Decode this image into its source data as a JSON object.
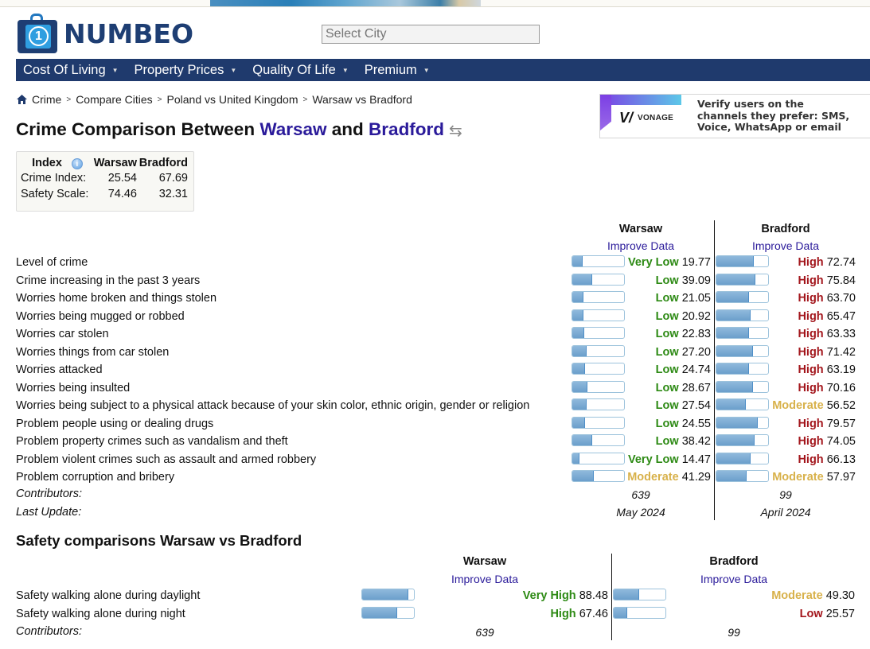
{
  "header": {
    "logo_text": "NUMBEO",
    "search_placeholder": "Select City"
  },
  "nav": [
    {
      "label": "Cost Of Living"
    },
    {
      "label": "Property Prices"
    },
    {
      "label": "Quality Of Life"
    },
    {
      "label": "Premium"
    }
  ],
  "breadcrumb": [
    "Crime",
    "Compare Cities",
    "Poland vs United Kingdom",
    "Warsaw vs Bradford"
  ],
  "ad": {
    "brand": "VONAGE",
    "copy_lines": [
      "Verify users on the",
      "channels they prefer: SMS,",
      "Voice, WhatsApp or email"
    ]
  },
  "title": {
    "prefix": "Crime Comparison Between ",
    "city1": "Warsaw",
    "middle": " and ",
    "city2": "Bradford",
    "swap_icon": "⇆"
  },
  "index_table": {
    "headers": [
      "Index",
      "Warsaw",
      "Bradford"
    ],
    "rows": [
      {
        "label": "Crime Index:",
        "warsaw": "25.54",
        "bradford": "67.69"
      },
      {
        "label": "Safety Scale:",
        "warsaw": "74.46",
        "bradford": "32.31"
      }
    ]
  },
  "crime": {
    "cities": [
      "Warsaw",
      "Bradford"
    ],
    "improve_label": "Improve Data",
    "rows": [
      {
        "label": "Level of crime",
        "w": {
          "level": "Very Low",
          "value": 19.77,
          "tone": "green"
        },
        "b": {
          "level": "High",
          "value": 72.74,
          "tone": "red"
        }
      },
      {
        "label": "Crime increasing in the past 3 years",
        "w": {
          "level": "Low",
          "value": 39.09,
          "tone": "green"
        },
        "b": {
          "level": "High",
          "value": 75.84,
          "tone": "red"
        }
      },
      {
        "label": "Worries home broken and things stolen",
        "w": {
          "level": "Low",
          "value": 21.05,
          "tone": "green"
        },
        "b": {
          "level": "High",
          "value": 63.7,
          "tone": "red"
        }
      },
      {
        "label": "Worries being mugged or robbed",
        "w": {
          "level": "Low",
          "value": 20.92,
          "tone": "green"
        },
        "b": {
          "level": "High",
          "value": 65.47,
          "tone": "red"
        }
      },
      {
        "label": "Worries car stolen",
        "w": {
          "level": "Low",
          "value": 22.83,
          "tone": "green"
        },
        "b": {
          "level": "High",
          "value": 63.33,
          "tone": "red"
        }
      },
      {
        "label": "Worries things from car stolen",
        "w": {
          "level": "Low",
          "value": 27.2,
          "tone": "green"
        },
        "b": {
          "level": "High",
          "value": 71.42,
          "tone": "red"
        }
      },
      {
        "label": "Worries attacked",
        "w": {
          "level": "Low",
          "value": 24.74,
          "tone": "green"
        },
        "b": {
          "level": "High",
          "value": 63.19,
          "tone": "red"
        }
      },
      {
        "label": "Worries being insulted",
        "w": {
          "level": "Low",
          "value": 28.67,
          "tone": "green"
        },
        "b": {
          "level": "High",
          "value": 70.16,
          "tone": "red"
        }
      },
      {
        "label": "Worries being subject to a physical attack because of your skin color, ethnic origin, gender or religion",
        "w": {
          "level": "Low",
          "value": 27.54,
          "tone": "green"
        },
        "b": {
          "level": "Moderate",
          "value": 56.52,
          "tone": "mod"
        }
      },
      {
        "label": "Problem people using or dealing drugs",
        "w": {
          "level": "Low",
          "value": 24.55,
          "tone": "green"
        },
        "b": {
          "level": "High",
          "value": 79.57,
          "tone": "red"
        }
      },
      {
        "label": "Problem property crimes such as vandalism and theft",
        "w": {
          "level": "Low",
          "value": 38.42,
          "tone": "green"
        },
        "b": {
          "level": "High",
          "value": 74.05,
          "tone": "red"
        }
      },
      {
        "label": "Problem violent crimes such as assault and armed robbery",
        "w": {
          "level": "Very Low",
          "value": 14.47,
          "tone": "green"
        },
        "b": {
          "level": "High",
          "value": 66.13,
          "tone": "red"
        }
      },
      {
        "label": "Problem corruption and bribery",
        "w": {
          "level": "Moderate",
          "value": 41.29,
          "tone": "mod"
        },
        "b": {
          "level": "Moderate",
          "value": 57.97,
          "tone": "mod"
        }
      }
    ],
    "contributors_label": "Contributors:",
    "contributors": [
      "639",
      "99"
    ],
    "last_update_label": "Last Update:",
    "last_update": [
      "May 2024",
      "April 2024"
    ]
  },
  "safety": {
    "title": "Safety comparisons Warsaw vs Bradford",
    "cities": [
      "Warsaw",
      "Bradford"
    ],
    "improve_label": "Improve Data",
    "rows": [
      {
        "label": "Safety walking alone during daylight",
        "w": {
          "level": "Very High",
          "value": 88.48,
          "tone": "green"
        },
        "b": {
          "level": "Moderate",
          "value": 49.3,
          "tone": "mod"
        }
      },
      {
        "label": "Safety walking alone during night",
        "w": {
          "level": "High",
          "value": 67.46,
          "tone": "green"
        },
        "b": {
          "level": "Low",
          "value": 25.57,
          "tone": "red"
        }
      }
    ],
    "contributors_label": "Contributors:",
    "contributors": [
      "639",
      "99"
    ]
  },
  "colors": {
    "nav_bg": "#1f3a6d",
    "city_link": "#2a1a9a",
    "good": "#2d8a14",
    "bad": "#a3161c",
    "moderate": "#d8b14a",
    "bar_fill": "#7aaad2"
  }
}
